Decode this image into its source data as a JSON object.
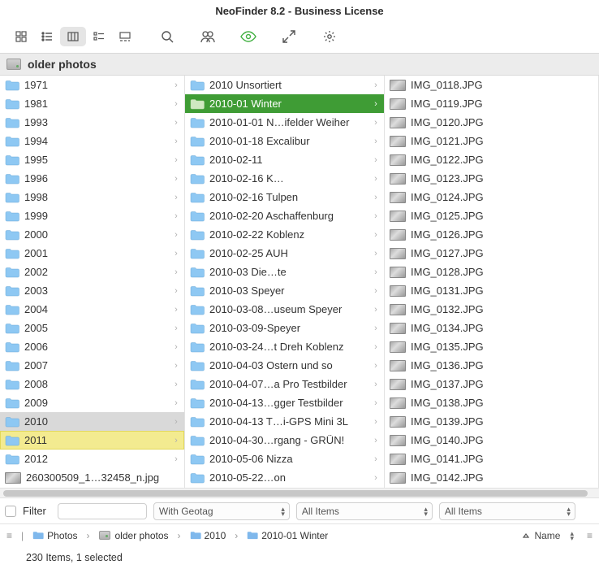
{
  "title": "NeoFinder 8.2 - Business License",
  "path_header": "older photos",
  "filter": {
    "label": "Filter",
    "select1": "With Geotag",
    "select2": "All Items",
    "select3": "All Items"
  },
  "breadcrumbs": [
    "Photos",
    "older photos",
    "2010",
    "2010-01 Winter"
  ],
  "sort_label": "Name",
  "status": "230 Items, 1 selected",
  "col1": [
    {
      "label": "1971",
      "chev": true
    },
    {
      "label": "1981",
      "chev": true
    },
    {
      "label": "1993",
      "chev": true
    },
    {
      "label": "1994",
      "chev": true
    },
    {
      "label": "1995",
      "chev": true
    },
    {
      "label": "1996",
      "chev": true
    },
    {
      "label": "1998",
      "chev": true
    },
    {
      "label": "1999",
      "chev": true
    },
    {
      "label": "2000",
      "chev": true
    },
    {
      "label": "2001",
      "chev": true
    },
    {
      "label": "2002",
      "chev": true
    },
    {
      "label": "2003",
      "chev": true
    },
    {
      "label": "2004",
      "chev": true
    },
    {
      "label": "2005",
      "chev": true
    },
    {
      "label": "2006",
      "chev": true
    },
    {
      "label": "2007",
      "chev": true
    },
    {
      "label": "2008",
      "chev": true
    },
    {
      "label": "2009",
      "chev": true
    },
    {
      "label": "2010",
      "chev": true,
      "sel": "grey"
    },
    {
      "label": "2011",
      "chev": true,
      "sel": "mark"
    },
    {
      "label": "2012",
      "chev": true
    },
    {
      "label": "260300509_1…32458_n.jpg",
      "thumb": true
    }
  ],
  "col2": [
    {
      "label": "2010 Unsortiert",
      "chev": true
    },
    {
      "label": "2010-01 Winter",
      "chev": true,
      "sel": "green"
    },
    {
      "label": "2010-01-01 N…ifelder Weiher",
      "chev": true
    },
    {
      "label": "2010-01-18 Excalibur",
      "chev": true
    },
    {
      "label": "2010-02-11",
      "chev": true
    },
    {
      "label": "2010-02-16 K…",
      "chev": true
    },
    {
      "label": "2010-02-16 Tulpen",
      "chev": true
    },
    {
      "label": "2010-02-20 Aschaffenburg",
      "chev": true
    },
    {
      "label": "2010-02-22 Koblenz",
      "chev": true
    },
    {
      "label": "2010-02-25 AUH",
      "chev": true
    },
    {
      "label": "2010-03 Die…te",
      "chev": true
    },
    {
      "label": "2010-03 Speyer",
      "chev": true
    },
    {
      "label": "2010-03-08…useum Speyer",
      "chev": true
    },
    {
      "label": "2010-03-09-Speyer",
      "chev": true
    },
    {
      "label": "2010-03-24…t Dreh Koblenz",
      "chev": true
    },
    {
      "label": "2010-04-03 Ostern und so",
      "chev": true
    },
    {
      "label": "2010-04-07…a Pro Testbilder",
      "chev": true
    },
    {
      "label": "2010-04-13…gger Testbilder",
      "chev": true
    },
    {
      "label": "2010-04-13 T…i-GPS Mini 3L",
      "chev": true
    },
    {
      "label": "2010-04-30…rgang - GRÜN!",
      "chev": true
    },
    {
      "label": "2010-05-06 Nizza",
      "chev": true
    },
    {
      "label": "2010-05-22…on",
      "chev": true
    }
  ],
  "col3": [
    {
      "label": "IMG_0118.JPG"
    },
    {
      "label": "IMG_0119.JPG"
    },
    {
      "label": "IMG_0120.JPG"
    },
    {
      "label": "IMG_0121.JPG"
    },
    {
      "label": "IMG_0122.JPG"
    },
    {
      "label": "IMG_0123.JPG"
    },
    {
      "label": "IMG_0124.JPG"
    },
    {
      "label": "IMG_0125.JPG"
    },
    {
      "label": "IMG_0126.JPG"
    },
    {
      "label": "IMG_0127.JPG"
    },
    {
      "label": "IMG_0128.JPG"
    },
    {
      "label": "IMG_0131.JPG"
    },
    {
      "label": "IMG_0132.JPG"
    },
    {
      "label": "IMG_0134.JPG"
    },
    {
      "label": "IMG_0135.JPG"
    },
    {
      "label": "IMG_0136.JPG"
    },
    {
      "label": "IMG_0137.JPG"
    },
    {
      "label": "IMG_0138.JPG"
    },
    {
      "label": "IMG_0139.JPG"
    },
    {
      "label": "IMG_0140.JPG"
    },
    {
      "label": "IMG_0141.JPG"
    },
    {
      "label": "IMG_0142.JPG"
    }
  ]
}
